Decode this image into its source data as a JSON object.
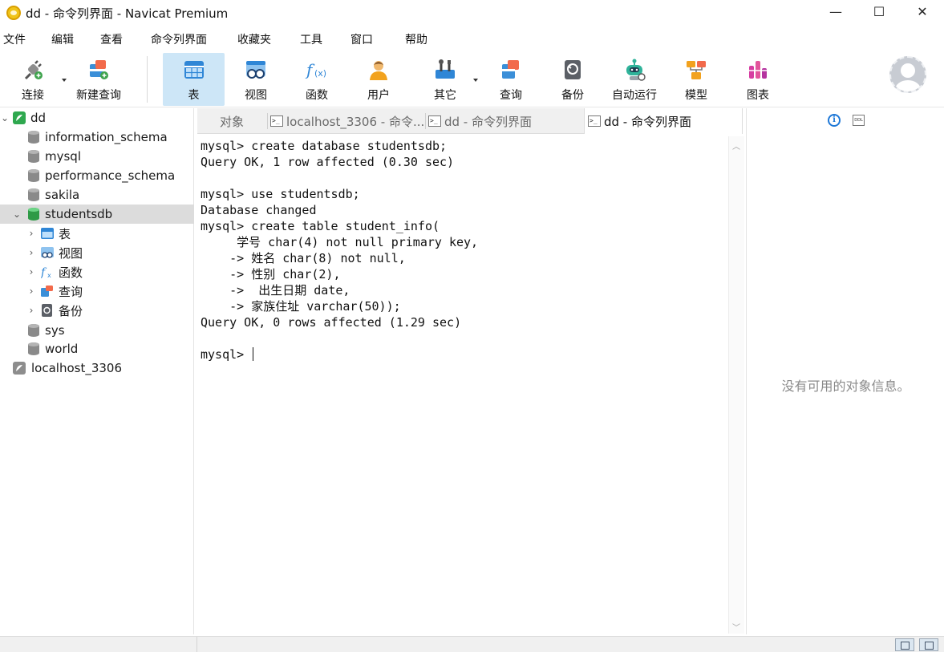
{
  "window": {
    "title": "dd - 命令列界面 - Navicat Premium",
    "minimize": "—",
    "maximize": "☐",
    "close": "✕"
  },
  "menu": [
    "文件",
    "编辑",
    "查看",
    "命令列界面",
    "收藏夹",
    "工具",
    "窗口",
    "帮助"
  ],
  "toolbar": {
    "connect": "连接",
    "new_query": "新建查询",
    "table": "表",
    "view": "视图",
    "function": "函数",
    "user": "用户",
    "other": "其它",
    "query": "查询",
    "backup": "备份",
    "automation": "自动运行",
    "model": "模型",
    "chart": "图表",
    "active": "表"
  },
  "tree": {
    "connection": "dd",
    "databases": [
      "information_schema",
      "mysql",
      "performance_schema",
      "sakila",
      "studentsdb"
    ],
    "selected_db": "studentsdb",
    "children": [
      "表",
      "视图",
      "函数",
      "查询",
      "备份"
    ],
    "more_databases": [
      "sys",
      "world"
    ],
    "other_connection": "localhost_3306"
  },
  "tabs": {
    "objects": "对象",
    "tab1": "localhost_3306 - 命令...",
    "tab2": "dd - 命令列界面",
    "tab3": "dd - 命令列界面"
  },
  "console": {
    "lines": [
      "mysql> create database studentsdb;",
      "Query OK, 1 row affected (0.30 sec)",
      "",
      "mysql> use studentsdb;",
      "Database changed",
      "mysql> create table student_info(",
      "     学号 char(4) not null primary key,",
      "    -> 姓名 char(8) not null,",
      "    -> 性别 char(2),",
      "    ->  出生日期 date,",
      "    -> 家族住址 varchar(50));",
      "Query OK, 0 rows affected (1.29 sec)",
      "",
      "mysql> "
    ]
  },
  "right_panel": {
    "info_icon": "i",
    "ddl_icon": "DDL",
    "message": "没有可用的对象信息。"
  },
  "colors": {
    "active_toolbar": "#cde6f7",
    "selected_row": "#dcdcdc",
    "db_green": "#2e9a46",
    "info_blue": "#1e78d7"
  }
}
